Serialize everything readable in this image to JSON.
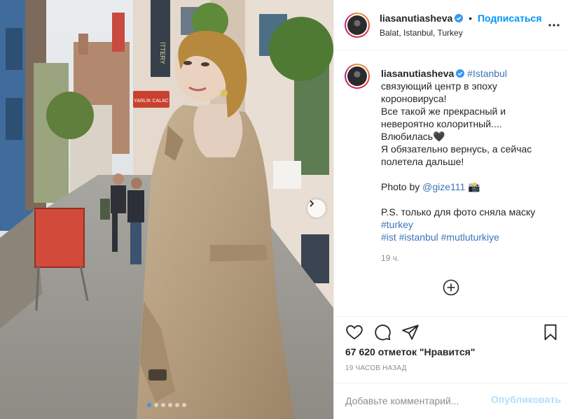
{
  "post": {
    "username": "liasanutiasheva",
    "separator": "•",
    "follow_label": "Подписаться",
    "location": "Balat, Istanbul, Turkey"
  },
  "caption": {
    "username": "liasanutiasheva",
    "hashtag_istanbul": "#Istanbul",
    "lines": [
      "связующий центр в эпоху",
      "короновируса!",
      "Все такой же прекрасный и",
      "невероятно колоритный....",
      "Влюбилась🖤",
      "Я обязательно вернусь, а сейчас",
      "полетела дальше!"
    ],
    "photo_by_prefix": "Photo by ",
    "photo_by_handle": "@gize111",
    "photo_by_suffix": " 📸",
    "ps_line": "P.S. только для фото сняла маску",
    "tag_turkey": "#turkey",
    "tag_ist": "#ist",
    "tag_istanbul": "#istanbul",
    "tag_mutlu": "#mutluturkiye",
    "time_ago": "19 ч."
  },
  "photo": {
    "sign_text": "YARLIK CALAC",
    "banner_text": "İTTERY",
    "carousel_dots": 6,
    "active_dot": 0
  },
  "actions": {
    "likes": "67 620 отметок \"Нравится\"",
    "timestamp": "19 ЧАСОВ НАЗАД"
  },
  "comment": {
    "placeholder": "Добавьте комментарий...",
    "post_label": "Опубликовать"
  },
  "icons": {
    "verified": "verified-badge-icon",
    "more": "more-options-icon",
    "plus": "load-more-comments-icon",
    "like": "heart-icon",
    "comment": "comment-icon",
    "share": "share-icon",
    "save": "bookmark-icon",
    "next": "chevron-right-icon"
  },
  "colors": {
    "accent": "#0095f6",
    "hashtag": "#00376b",
    "muted": "#8e8e8e",
    "post_disabled": "#b2dffc"
  }
}
